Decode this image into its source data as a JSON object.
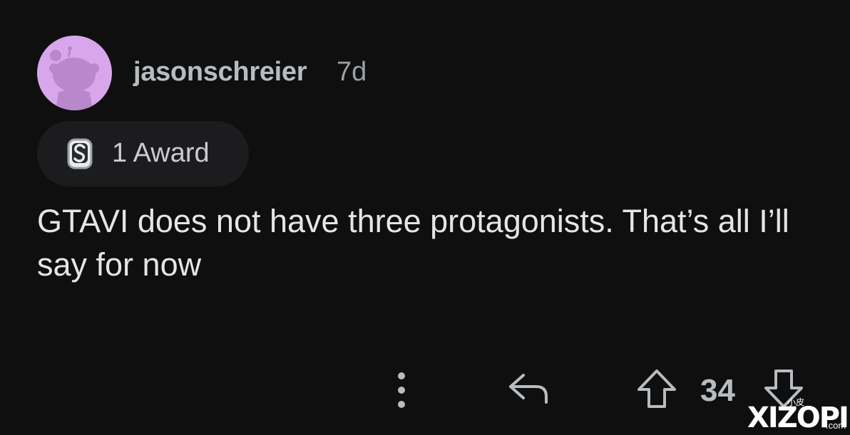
{
  "comment": {
    "username": "jasonschreier",
    "age": "7d",
    "award_count_label": "1 Award",
    "body": "GTAVI does not have three protagonists. That’s all I’ll say for now",
    "score": "34"
  },
  "icons": {
    "avatar": "reddit-snoo-avatar",
    "award": "award-icon",
    "more": "more-options-icon",
    "reply": "reply-arrow-icon",
    "upvote": "upvote-arrow-icon",
    "downvote": "downvote-arrow-icon"
  },
  "colors": {
    "background": "#0f0f10",
    "avatar_bg": "#d8a6ea",
    "text": "#e3e5e7",
    "muted": "#9aa0a4"
  },
  "watermark": {
    "small": "小皮",
    "main": "XIZOPI",
    "domain": ".com"
  }
}
